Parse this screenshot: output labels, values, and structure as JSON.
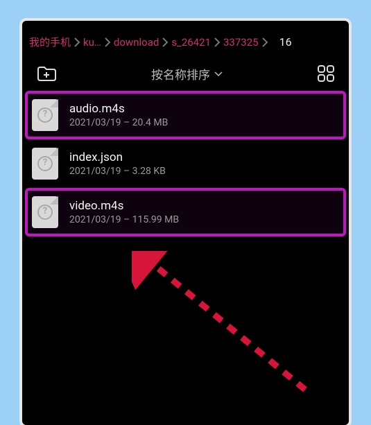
{
  "breadcrumb": {
    "items": [
      "我的手机",
      "ku…",
      "download",
      "s_26421",
      "337325"
    ],
    "count": "16"
  },
  "toolbar": {
    "sort_label": "按名称排序"
  },
  "files": [
    {
      "name": "audio.m4s",
      "meta": "2021/03/19 – 20.4 MB",
      "highlighted": true
    },
    {
      "name": "index.json",
      "meta": "2021/03/19 – 3.28 KB",
      "highlighted": false
    },
    {
      "name": "video.m4s",
      "meta": "2021/03/19 – 115.99 MB",
      "highlighted": true
    }
  ]
}
